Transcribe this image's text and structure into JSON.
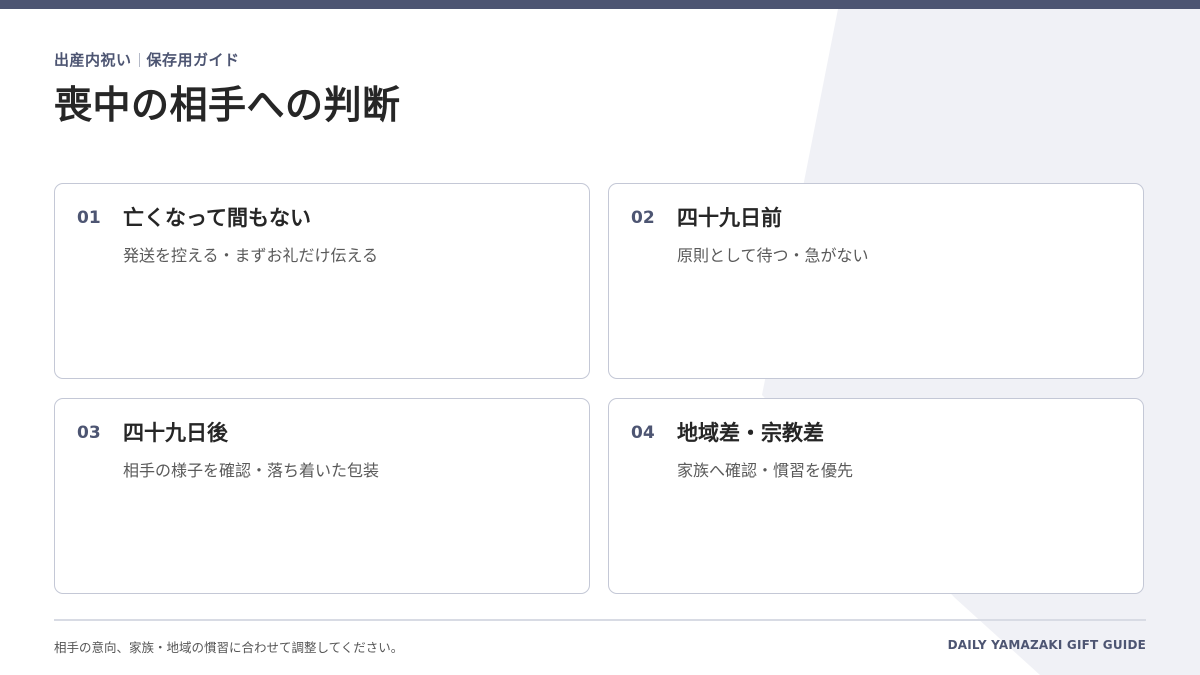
{
  "header": {
    "category": "出産内祝い",
    "subcategory": "保存用ガイド",
    "title": "喪中の相手への判断"
  },
  "cards": [
    {
      "number": "01",
      "title": "亡くなって間もない",
      "description": "発送を控える・まずお礼だけ伝える"
    },
    {
      "number": "02",
      "title": "四十九日前",
      "description": "原則として待つ・急がない"
    },
    {
      "number": "03",
      "title": "四十九日後",
      "description": "相手の様子を確認・落ち着いた包装"
    },
    {
      "number": "04",
      "title": "地域差・宗教差",
      "description": "家族へ確認・慣習を優先"
    }
  ],
  "footer": {
    "note": "相手の意向、家族・地域の慣習に合わせて調整してください。",
    "brand": "DAILY YAMAZAKI GIFT GUIDE"
  },
  "colors": {
    "accent": "#4d5572",
    "background_shape": "#f0f1f6",
    "card_border": "#c4c8d6"
  }
}
